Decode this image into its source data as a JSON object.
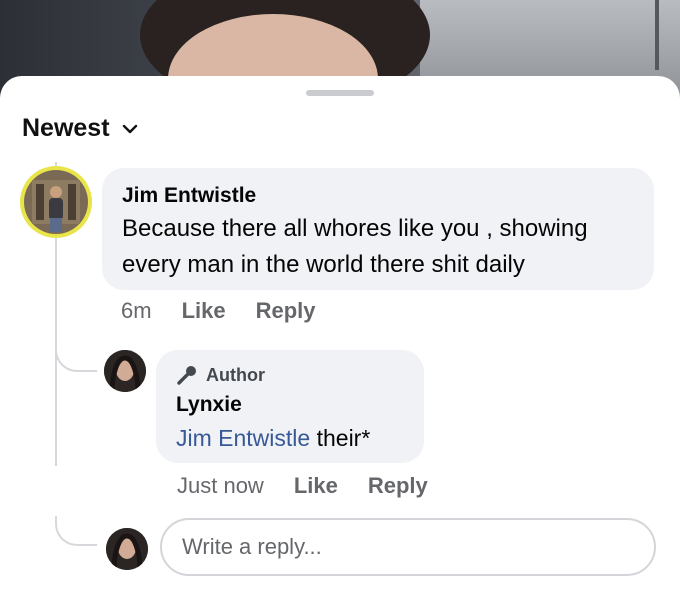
{
  "sort": {
    "label": "Newest"
  },
  "comments": [
    {
      "author": "Jim Entwistle",
      "text": "Because there all whores like you , showing every man in the world there shit daily",
      "text_line1": "Because there all whores like you , showing",
      "text_line2": "every man in the world there shit daily",
      "time": "6m",
      "like": "Like",
      "reply": "Reply"
    },
    {
      "badge": "Author",
      "author": "Lynxie",
      "mention": "Jim Entwistle",
      "text": "their*",
      "time": "Just now",
      "like": "Like",
      "reply": "Reply"
    }
  ],
  "composer": {
    "placeholder": "Write a reply..."
  },
  "colors": {
    "mention": "#385898",
    "bubble": "#f0f2f5",
    "muted": "#65676b"
  }
}
